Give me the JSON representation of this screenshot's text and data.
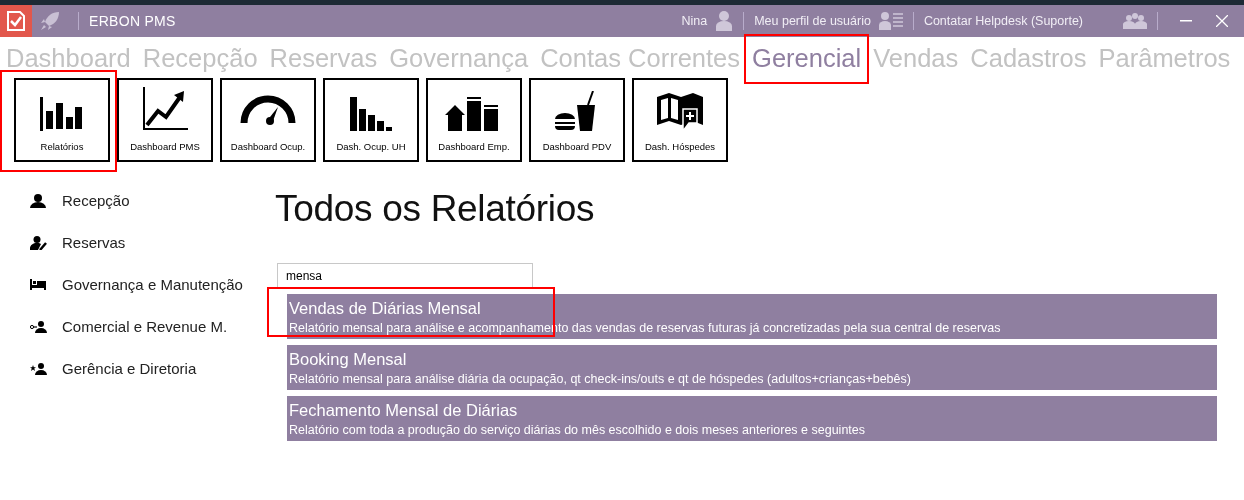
{
  "window": {
    "title": "ERBON PMS",
    "user": "Nina",
    "profile_link": "Meu perfil de usuário",
    "helpdesk_link": "Contatar Helpdesk (Suporte)"
  },
  "tabs": [
    {
      "label": "Dashboard",
      "selected": false,
      "highlighted": false
    },
    {
      "label": "Recepção",
      "selected": false,
      "highlighted": false
    },
    {
      "label": "Reservas",
      "selected": false,
      "highlighted": false
    },
    {
      "label": "Governança",
      "selected": false,
      "highlighted": false
    },
    {
      "label": "Contas Correntes",
      "selected": false,
      "highlighted": false
    },
    {
      "label": "Gerencial",
      "selected": true,
      "highlighted": true
    },
    {
      "label": "Vendas",
      "selected": false,
      "highlighted": false
    },
    {
      "label": "Cadastros",
      "selected": false,
      "highlighted": false
    },
    {
      "label": "Parâmetros",
      "selected": false,
      "highlighted": false
    }
  ],
  "tiles": [
    {
      "label": "Relatórios",
      "kind": "bars",
      "highlighted": true
    },
    {
      "label": "Dashboard PMS",
      "kind": "trend",
      "highlighted": false
    },
    {
      "label": "Dashboard Ocup.",
      "kind": "gauge",
      "highlighted": false
    },
    {
      "label": "Dash. Ocup. UH",
      "kind": "descending",
      "highlighted": false
    },
    {
      "label": "Dashboard Emp.",
      "kind": "buildings",
      "highlighted": false
    },
    {
      "label": "Dashboard PDV",
      "kind": "food",
      "highlighted": false
    },
    {
      "label": "Dash. Hóspedes",
      "kind": "map",
      "highlighted": false
    }
  ],
  "sidebar": {
    "items": [
      {
        "label": "Recepção",
        "kind": "person"
      },
      {
        "label": "Reservas",
        "kind": "person-edit"
      },
      {
        "label": "Governança e Manutenção",
        "kind": "bed"
      },
      {
        "label": "Comercial e Revenue M.",
        "kind": "person-key"
      },
      {
        "label": "Gerência e Diretoria",
        "kind": "person-star"
      }
    ]
  },
  "page_title": "Todos os Relatórios",
  "search": {
    "value": "mensa"
  },
  "results": [
    {
      "title": "Vendas de Diárias Mensal",
      "description": "Relatório mensal para análise e acompanhamento das vendas de reservas futuras já concretizadas pela sua central de reservas",
      "highlighted": true
    },
    {
      "title": "Booking Mensal",
      "description": "Relatório mensal para análise diária da ocupação, qt check-ins/outs e qt de hóspedes (adultos+crianças+bebês)",
      "highlighted": false
    },
    {
      "title": "Fechamento Mensal de Diárias",
      "description": "Relatório com toda a produção do serviço diárias do mês escolhido e dois meses anteriores e seguintes",
      "highlighted": false
    }
  ]
}
